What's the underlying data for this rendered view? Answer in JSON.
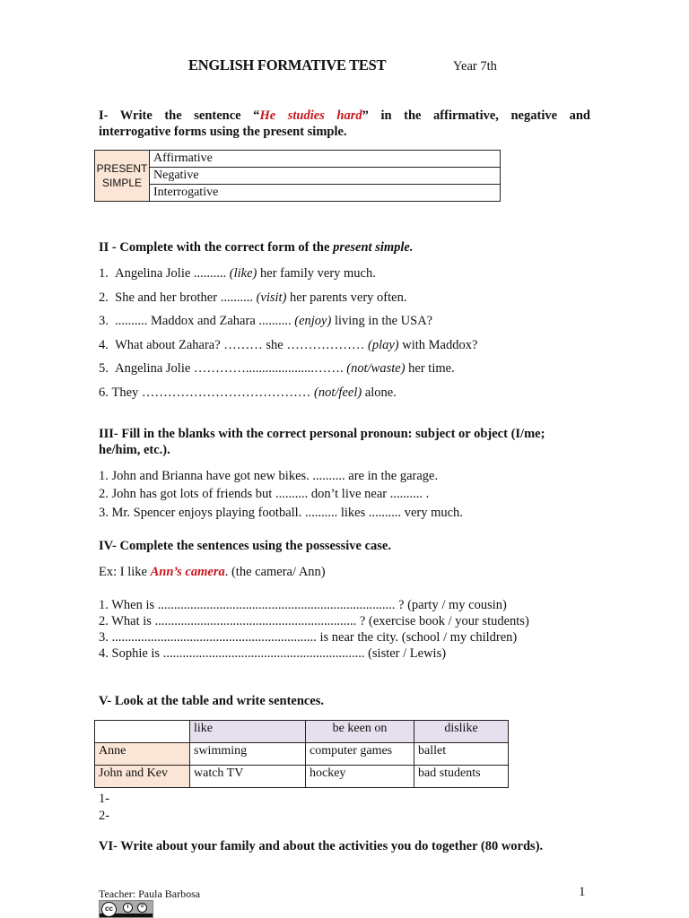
{
  "header": {
    "title": "ENGLISH FORMATIVE TEST",
    "year": "Year 7th"
  },
  "section1": {
    "heading_prefix": "I- Write the sentence “",
    "heading_highlight": "He studies hard",
    "heading_suffix": "” in the affirmative, negative and",
    "heading_line2": "interrogative forms using the present simple.",
    "table": {
      "row_label": [
        "PRESENT",
        "SIMPLE"
      ],
      "rows": [
        "Affirmative",
        "Negative",
        "Interrogative"
      ]
    }
  },
  "section2": {
    "heading_prefix": "II - Complete with the correct form of the ",
    "heading_italic": "present simple.",
    "items": [
      {
        "num": "1.",
        "before": "Angelina Jolie .......... ",
        "verb": "(like)",
        "after": " her family very much."
      },
      {
        "num": "2.",
        "before": "She and her brother .......... ",
        "verb": "(visit)",
        "after": " her parents very often."
      },
      {
        "num": "3.",
        "before": ".......... Maddox and Zahara .......... ",
        "verb": "(enjoy)",
        "after": " living in the USA?"
      },
      {
        "num": "4.",
        "before": "What about Zahara? ……… she ……………… ",
        "verb": "(play)",
        "after": " with Maddox?"
      },
      {
        "num": "5.",
        "before": "Angelina Jolie ………….....................……. ",
        "verb": "(not/waste)",
        "after": " her time."
      },
      {
        "num": "6.",
        "before": "They ………………………………… ",
        "verb": "(not/feel)",
        "after": " alone."
      }
    ]
  },
  "section3": {
    "heading_line1": "III- Fill in the blanks with the correct personal pronoun: subject or object (I/me;",
    "heading_line2": "he/him, etc.).",
    "items": [
      "1. John and Brianna have got new bikes. .......... are in the garage.",
      "2. John has got lots of friends but .......... don’t live near ..........  .",
      "3. Mr. Spencer enjoys playing football. .......... likes .......... very much."
    ]
  },
  "section4": {
    "heading": "IV- Complete the sentences using the possessive case.",
    "example_prefix": "Ex: I like ",
    "example_answer": "Ann’s camera",
    "example_suffix": ". (the camera/ Ann)",
    "items": [
      "1. When is ......................................................................... ? (party / my cousin)",
      "2. What is  ..............................................................  ? (exercise book / your students)",
      "3. ............................................................... is near the city. (school / my children)",
      "4. Sophie is .............................................................. (sister / Lewis)"
    ]
  },
  "section5": {
    "heading": "V- Look at the table and write sentences.",
    "table": {
      "headers": [
        "",
        "like",
        "be keen on",
        "dislike"
      ],
      "rows": [
        [
          "Anne",
          "swimming",
          "computer games",
          "ballet"
        ],
        [
          "John and Kev",
          "watch TV",
          "hockey",
          "bad students"
        ]
      ]
    },
    "answers": [
      "1-",
      "2-"
    ]
  },
  "section6": {
    "heading": "VI- Write about your family and about the activities you do together (80 words)."
  },
  "footer": {
    "teacher": "Teacher: Paula Barbosa",
    "page_number": "1",
    "license_icon": "cc-by-nd-icon"
  },
  "colors": {
    "highlight_red": "#c8161d",
    "row_label_bg": "#fbe5d6",
    "header_bg": "#e5dfee"
  }
}
